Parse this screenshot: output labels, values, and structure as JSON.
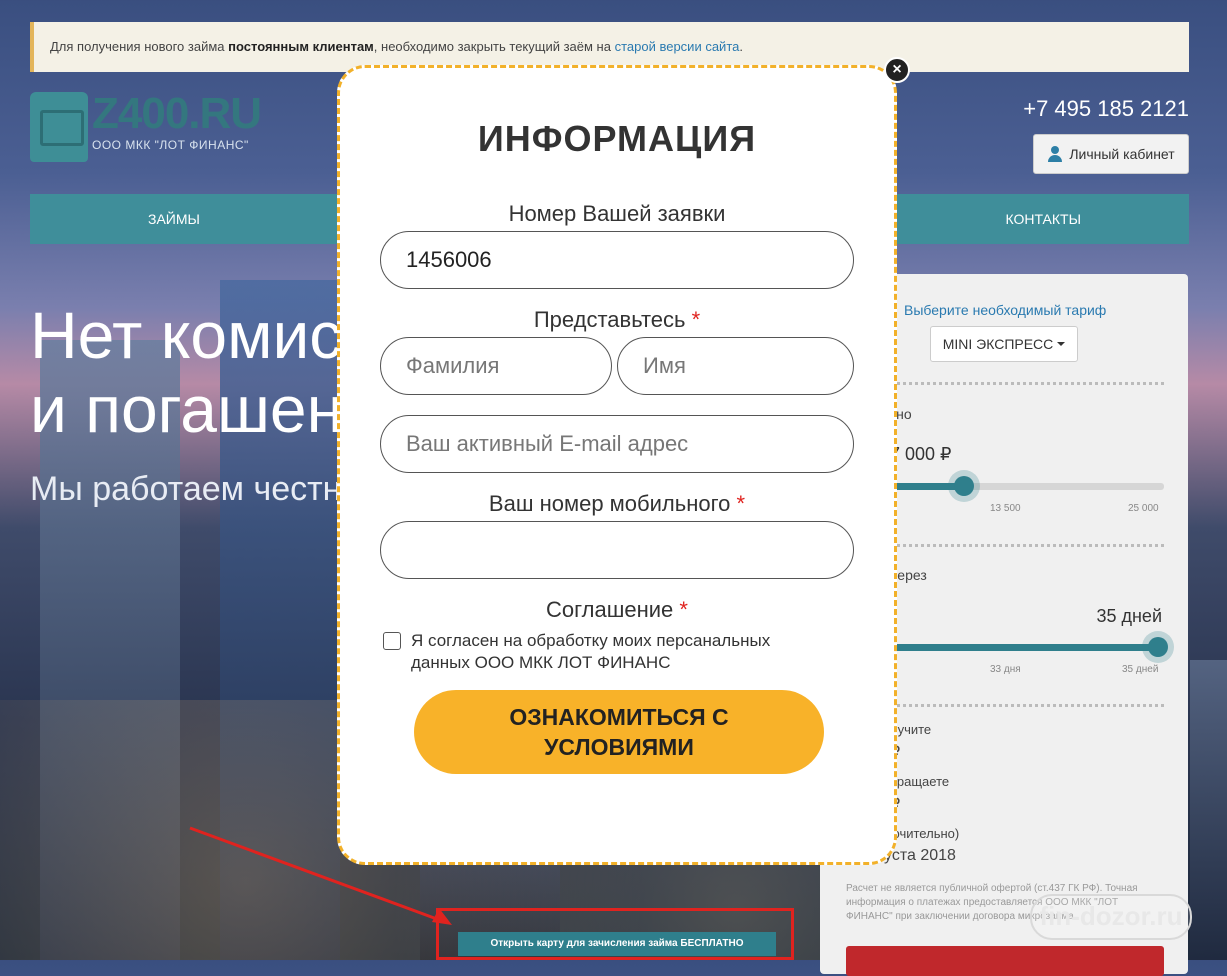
{
  "notice": {
    "text_before": "Для получения нового займа ",
    "bold": "постоянным клиентам",
    "text_middle": ", необходимо закрыть текущий заём на ",
    "link": "старой версии сайта",
    "text_end": "."
  },
  "header": {
    "logo_title": "Z400.RU",
    "logo_subtitle": "ООО МКК \"ЛОТ ФИНАНС\"",
    "phone": "+7 495 185 2121",
    "cabinet_label": "Личный кабинет"
  },
  "nav": {
    "loans": "ЗАЙМЫ",
    "contacts": "КОНТАКТЫ"
  },
  "hero": {
    "title": "Нет комис\nи погашен",
    "subtitle": "Мы работаем честн"
  },
  "calculator": {
    "tariff_label": "Выберите необходимый тариф",
    "tariff_value": "MINI ЭКСПРЕСС",
    "amount_label": "кно",
    "amount_value": "7 000 ₽",
    "amount_progress": 0.27,
    "amount_ticks": [
      "13 500",
      "25 000"
    ],
    "term_label": "через",
    "term_value": "35 дней",
    "term_progress": 1.0,
    "term_ticks": [
      "33 дня",
      "35 дней"
    ],
    "receive_label": "лучите",
    "receive_value": "₽",
    "return_label": "вращаете",
    "return_value": "₽",
    "date_label": "ючительно)",
    "date_value": "уста 2018",
    "disclaimer": "Расчет не является публичной офертой (ст.437 ГК РФ). Точная информация о платежах предоставляется ООО МКК \"ЛОТ ФИНАНС\" при заключении договора микрозайма"
  },
  "card_button": "Открыть карту для зачисления займа БЕСПЛАТНО",
  "watermark": "fin-dozor.ru",
  "modal": {
    "title": "ИНФОРМАЦИЯ",
    "application_label": "Номер Вашей заявки",
    "application_value": "1456006",
    "introduce_label": "Представьтесь",
    "lastname_placeholder": "Фамилия",
    "firstname_placeholder": "Имя",
    "email_placeholder": "Ваш активный E-mail адрес",
    "phone_label": "Ваш номер мобильного",
    "agreement_label": "Соглашение",
    "agreement_text": "Я согласен на обработку моих персанальных данных ООО МКК ЛОТ ФИНАНС",
    "required_mark": "*",
    "submit_label": "ОЗНАКОМИТЬСЯ С\nУСЛОВИЯМИ",
    "close_symbol": "×"
  },
  "colors": {
    "accent": "#3f8e9a",
    "button": "#f8b229",
    "modal_border": "#f2b12a",
    "link": "#2a7ab0",
    "required": "#e0231f"
  }
}
